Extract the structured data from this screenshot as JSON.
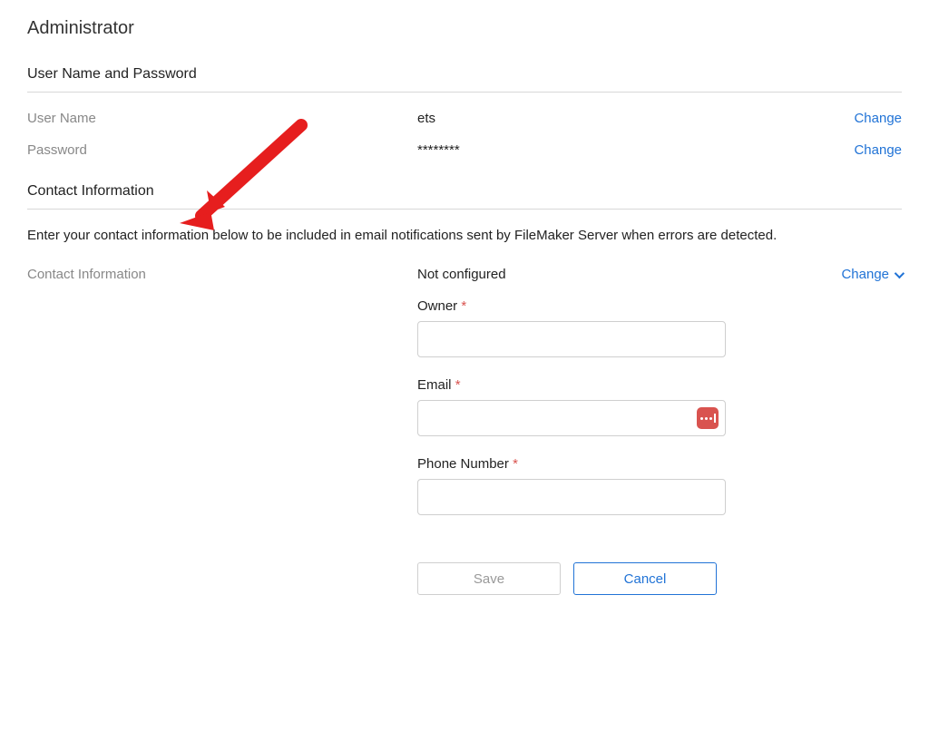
{
  "page_title": "Administrator",
  "sections": {
    "credentials": {
      "title": "User Name and Password",
      "username_label": "User Name",
      "username_value": "ets",
      "username_action": "Change",
      "password_label": "Password",
      "password_value": "********",
      "password_action": "Change"
    },
    "contact": {
      "title": "Contact Information",
      "help_text": "Enter your contact information below to be included in email notifications sent by FileMaker Server when errors are detected.",
      "label": "Contact Information",
      "status": "Not configured",
      "action": "Change",
      "fields": {
        "owner_label": "Owner",
        "owner_value": "",
        "email_label": "Email",
        "email_value": "",
        "phone_label": "Phone Number",
        "phone_value": ""
      },
      "save_label": "Save",
      "cancel_label": "Cancel"
    }
  },
  "required_marker": "*"
}
